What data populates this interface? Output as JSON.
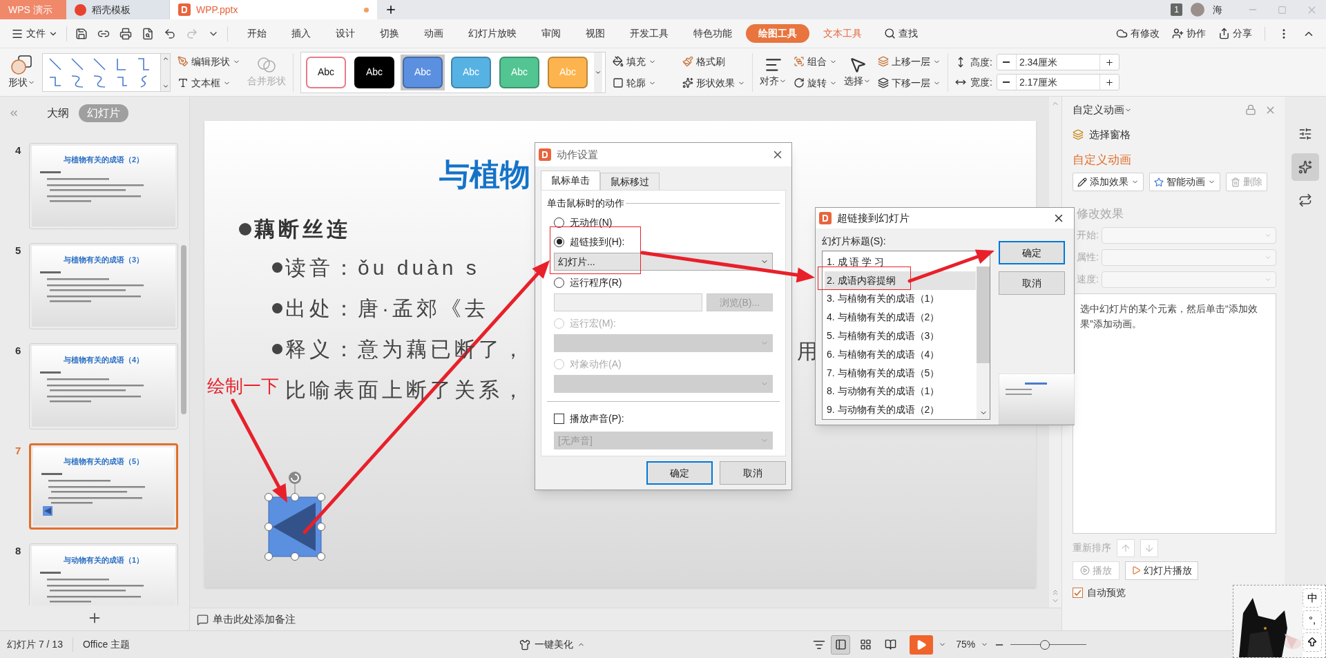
{
  "tabs": [
    {
      "label": "WPS 演示",
      "kind": "app",
      "selected": false
    },
    {
      "label": "稻壳模板",
      "kind": "template",
      "selected": false
    },
    {
      "label": "WPP.pptx",
      "kind": "file",
      "selected": true
    }
  ],
  "title_bar": {
    "window_count": "1",
    "user": "海"
  },
  "menu": {
    "file": "文件",
    "tabs": [
      {
        "label": "开始",
        "kind": "plain",
        "selected": false
      },
      {
        "label": "插入",
        "kind": "plain",
        "selected": false
      },
      {
        "label": "设计",
        "kind": "plain",
        "selected": false
      },
      {
        "label": "切换",
        "kind": "plain",
        "selected": false
      },
      {
        "label": "动画",
        "kind": "plain",
        "selected": false
      },
      {
        "label": "幻灯片放映",
        "kind": "plain",
        "selected": false
      },
      {
        "label": "审阅",
        "kind": "plain",
        "selected": false
      },
      {
        "label": "视图",
        "kind": "plain",
        "selected": false
      },
      {
        "label": "开发工具",
        "kind": "plain",
        "selected": false
      },
      {
        "label": "特色功能",
        "kind": "plain",
        "selected": false
      },
      {
        "label": "绘图工具",
        "kind": "context",
        "selected": true
      },
      {
        "label": "文本工具",
        "kind": "context",
        "selected": false
      }
    ],
    "search": "查找",
    "actions": [
      {
        "label": "有修改",
        "kind": "cloud"
      },
      {
        "label": "协作",
        "kind": "people"
      },
      {
        "label": "分享",
        "kind": "share"
      }
    ]
  },
  "ribbon": {
    "shape": "形状",
    "edit_shape": "编辑形状",
    "text_box": "文本框",
    "merge_shape": {
      "label": "合并形状",
      "disabled": true
    },
    "styles": [
      {
        "label": "Abc",
        "color": "#ffffff",
        "selected": false
      },
      {
        "label": "Abc",
        "color": "#000000",
        "selected": false
      },
      {
        "label": "Abc",
        "color": "#5b8fe0",
        "selected": true
      },
      {
        "label": "Abc",
        "color": "#56b2e3",
        "selected": false
      },
      {
        "label": "Abc",
        "color": "#52c592",
        "selected": false
      },
      {
        "label": "Abc",
        "color": "#fdb44e",
        "selected": false
      }
    ],
    "fill": "填充",
    "format_painter": "格式刷",
    "outline": "轮廓",
    "shape_effect": "形状效果",
    "align": "对齐",
    "group": "组合",
    "rotate": "旋转",
    "select": "选择",
    "bring_forward": "上移一层",
    "send_backward": "下移一层",
    "height_label": "高度:",
    "height": "2.34厘米",
    "width_label": "宽度:",
    "width": "2.17厘米"
  },
  "view_tabs": [
    {
      "label": "大纲",
      "selected": false
    },
    {
      "label": "幻灯片",
      "selected": true
    }
  ],
  "thumbnails": [
    {
      "number": "4",
      "title": "与植物有关的成语（2）",
      "selected": false,
      "has_shape": false
    },
    {
      "number": "5",
      "title": "与植物有关的成语（3）",
      "selected": false,
      "has_shape": false
    },
    {
      "number": "6",
      "title": "与植物有关的成语（4）",
      "selected": false,
      "has_shape": false
    },
    {
      "number": "7",
      "title": "与植物有关的成语（5）",
      "selected": true,
      "has_shape": true
    },
    {
      "number": "8",
      "title": "与动物有关的成语（1）",
      "selected": false
    }
  ],
  "slide": {
    "title": "与植物",
    "heading": "藕断丝连",
    "lines": [
      {
        "text": "读音：ǒu duàn s",
        "bullet": true
      },
      {
        "text": "出处：唐·孟郊《去",
        "bullet": true
      },
      {
        "text": "释义：意为藕已断了，",
        "bullet": true,
        "tail": "用"
      },
      {
        "text": "比喻表面上断了关系，",
        "bullet": false
      }
    ]
  },
  "annotation": "绘制一下",
  "action_dialog": {
    "title": "动作设置",
    "tabs": [
      {
        "label": "鼠标单击",
        "selected": true
      },
      {
        "label": "鼠标移过",
        "selected": false
      }
    ],
    "group": "单击鼠标时的动作",
    "options": [
      {
        "label": "无动作(N)",
        "selected": false,
        "disabled": false
      },
      {
        "label": "超链接到(H):",
        "selected": true,
        "disabled": false,
        "field": {
          "kind": "select",
          "value": "幻灯片...",
          "disabled": false
        }
      },
      {
        "label": "运行程序(R)",
        "selected": false,
        "disabled": false,
        "field": {
          "kind": "input",
          "button": "浏览(B)...",
          "disabled": true
        }
      },
      {
        "label": "运行宏(M):",
        "selected": false,
        "disabled": true,
        "field": {
          "kind": "select",
          "disabled": true
        }
      },
      {
        "label": "对象动作(A)",
        "selected": false,
        "disabled": true,
        "field": {
          "kind": "select",
          "disabled": true
        }
      }
    ],
    "sound": {
      "label": "播放声音(P):",
      "checked": false,
      "value": "[无声音]",
      "disabled": true
    },
    "buttons": [
      {
        "label": "确定",
        "primary": true
      },
      {
        "label": "取消",
        "primary": false
      }
    ]
  },
  "link_dialog": {
    "title": "超链接到幻灯片",
    "list_label": "幻灯片标题(S):",
    "slides": [
      {
        "label": "1. 成 语 学 习",
        "selected": false
      },
      {
        "label": "2. 成语内容提纲",
        "selected": true
      },
      {
        "label": "3. 与植物有关的成语（1）",
        "selected": false
      },
      {
        "label": "4. 与植物有关的成语（2）",
        "selected": false
      },
      {
        "label": "5. 与植物有关的成语（3）",
        "selected": false
      },
      {
        "label": "6. 与植物有关的成语（4）",
        "selected": false
      },
      {
        "label": "7. 与植物有关的成语（5）",
        "selected": false
      },
      {
        "label": "8. 与动物有关的成语（1）",
        "selected": false
      },
      {
        "label": "9. 与动物有关的成语（2）",
        "selected": false
      }
    ],
    "buttons": [
      {
        "label": "确定",
        "primary": true
      },
      {
        "label": "取消",
        "primary": false
      }
    ]
  },
  "task_pane": {
    "title": "自定义动画",
    "selection_pane": "选择窗格",
    "section": "自定义动画",
    "buttons": [
      {
        "label": "添加效果",
        "kind": "pen",
        "disabled": false
      },
      {
        "label": "智能动画",
        "kind": "star",
        "disabled": false
      },
      {
        "label": "删除",
        "kind": "trash",
        "disabled": true
      }
    ],
    "modify": "修改效果",
    "fields": [
      "开始:",
      "属性:",
      "速度:"
    ],
    "hint": "选中幻灯片的某个元素，然后单击“添加效果”添加动画。",
    "reorder": "重新排序",
    "play": {
      "label": "播放",
      "disabled": true
    },
    "slideshow": "幻灯片播放",
    "auto_preview": {
      "label": "自动预览",
      "checked": true
    }
  },
  "side_icons": [
    {
      "kind": "sliders",
      "selected": false
    },
    {
      "kind": "star",
      "selected": true
    },
    {
      "kind": "swap",
      "selected": false
    }
  ],
  "notes": "单击此处添加备注",
  "status": {
    "slide": "幻灯片 7 / 13",
    "theme": "Office 主题",
    "beautify": "一键美化",
    "zoom": "75%",
    "zoom_slider": {
      "level": 0.45
    },
    "views": [
      {
        "kind": "normal",
        "selected": true
      },
      {
        "kind": "sorter",
        "selected": false
      },
      {
        "kind": "reading",
        "selected": false
      }
    ]
  },
  "ime": {
    "keys": [
      "中",
      "°,"
    ]
  }
}
